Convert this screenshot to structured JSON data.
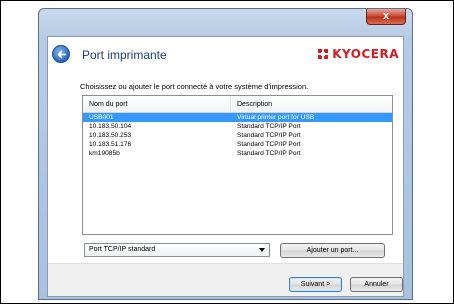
{
  "window": {
    "close_label": "x"
  },
  "header": {
    "title": "Port imprimante",
    "logo_text": "KYOCERA",
    "brand_color": "#d71920"
  },
  "instruction": "Choisissez ou ajouter le port connecté à votre système d'impression.",
  "list": {
    "columns": [
      "Nom du port",
      "Description"
    ],
    "rows": [
      {
        "name": "USB001",
        "description": "Virtual printer port for USB",
        "selected": true
      },
      {
        "name": "10.183.50.104",
        "description": "Standard TCP/IP Port"
      },
      {
        "name": "10.183.50.253",
        "description": "Standard TCP/IP Port"
      },
      {
        "name": "10.183.51.176",
        "description": "Standard TCP/IP Port"
      },
      {
        "name": "km19085b",
        "description": "Standard TCP/IP Port"
      }
    ]
  },
  "port_type": {
    "selected": "Port TCP/IP standard"
  },
  "buttons": {
    "add_port": "Ajouter un port...",
    "next": "Suivant >",
    "cancel": "Annuler"
  }
}
